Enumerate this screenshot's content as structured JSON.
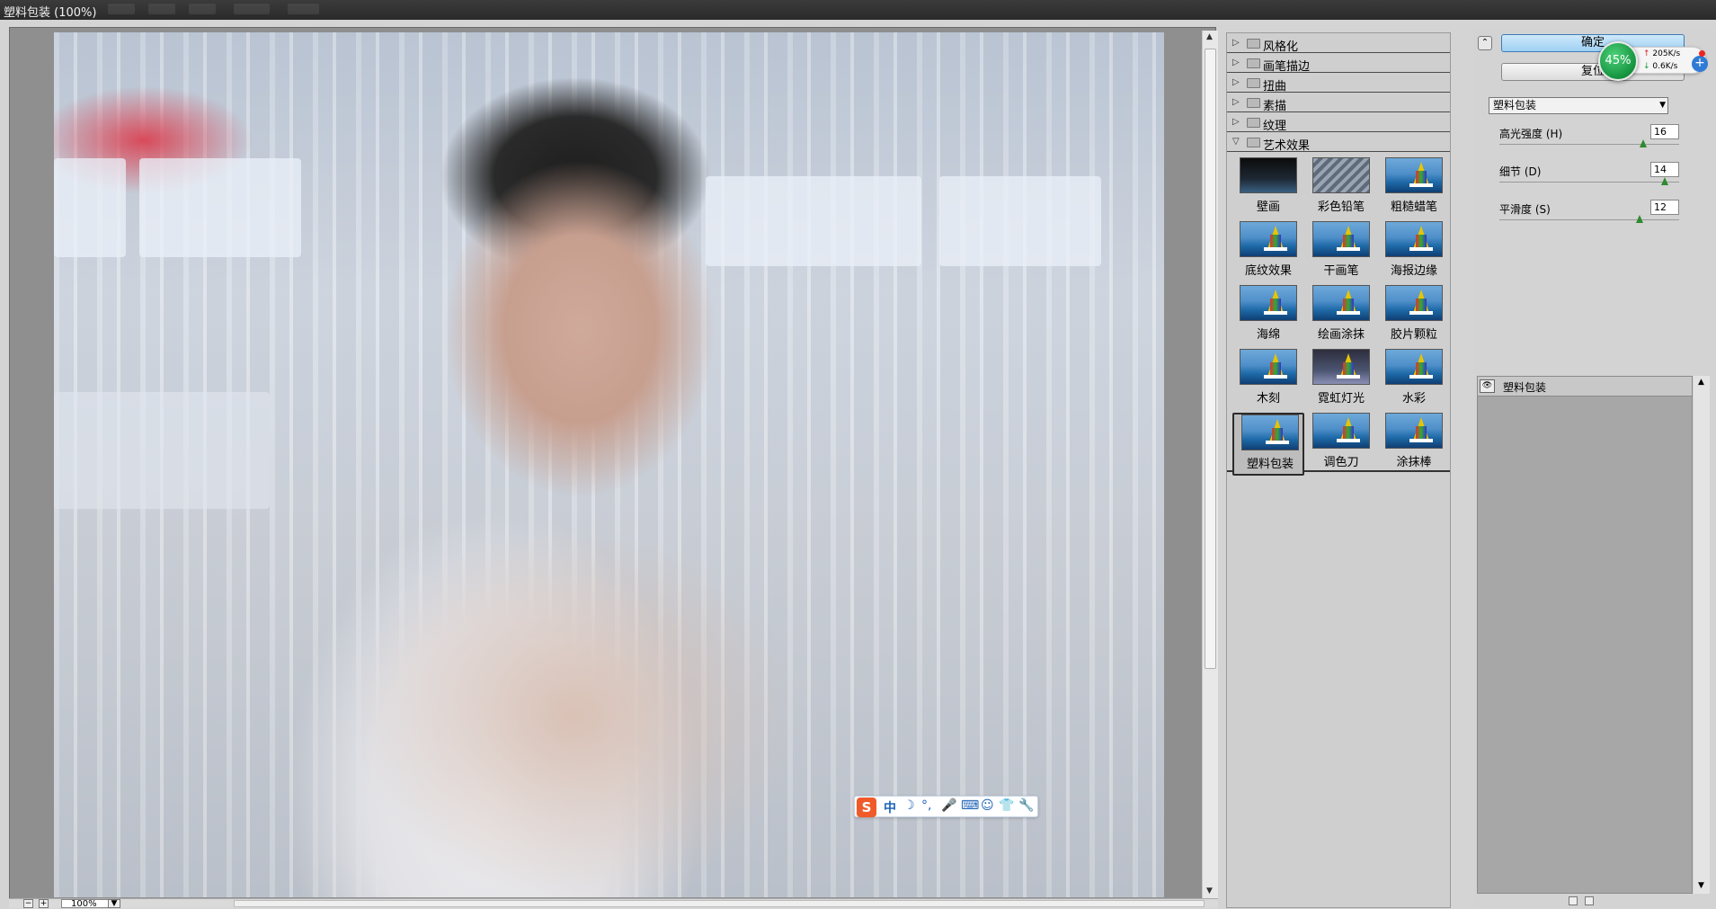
{
  "window": {
    "title": "塑料包装 (100%)"
  },
  "preview": {
    "zoom": "100%",
    "zoom_minus": "−",
    "zoom_plus": "+",
    "zoom_dropdown": "▼"
  },
  "gallery": {
    "folders": [
      {
        "label": "风格化",
        "expanded": false
      },
      {
        "label": "画笔描边",
        "expanded": false
      },
      {
        "label": "扭曲",
        "expanded": false
      },
      {
        "label": "素描",
        "expanded": false
      },
      {
        "label": "纹理",
        "expanded": false
      },
      {
        "label": "艺术效果",
        "expanded": true
      }
    ],
    "filters": [
      {
        "label": "壁画",
        "style": "dark"
      },
      {
        "label": "彩色铅笔",
        "style": "mesh"
      },
      {
        "label": "粗糙蜡笔",
        "style": "sea"
      },
      {
        "label": "底纹效果",
        "style": "sea"
      },
      {
        "label": "干画笔",
        "style": "sea"
      },
      {
        "label": "海报边缘",
        "style": "sea"
      },
      {
        "label": "海绵",
        "style": "sea"
      },
      {
        "label": "绘画涂抹",
        "style": "sea"
      },
      {
        "label": "胶片颗粒",
        "style": "sea"
      },
      {
        "label": "木刻",
        "style": "sea"
      },
      {
        "label": "霓虹灯光",
        "style": "neon"
      },
      {
        "label": "水彩",
        "style": "sea"
      },
      {
        "label": "塑料包装",
        "style": "sea",
        "selected": true
      },
      {
        "label": "调色刀",
        "style": "sea"
      },
      {
        "label": "涂抹棒",
        "style": "sea"
      }
    ]
  },
  "options": {
    "collapse_glyph": "⌃",
    "ok_label": "确定",
    "reset_label": "复位",
    "selected_filter": "塑料包装",
    "dropdown_glyph": "▼",
    "params": [
      {
        "label": "高光强度 (H)",
        "value": "16",
        "level": 0.8
      },
      {
        "label": "细节 (D)",
        "value": "14",
        "level": 0.92
      },
      {
        "label": "平滑度 (S)",
        "value": "12",
        "level": 0.78
      }
    ]
  },
  "layers": {
    "items": [
      {
        "label": "塑料包装",
        "eye": "👁"
      }
    ]
  },
  "network": {
    "percent": "45%",
    "upload": "205K/s",
    "download": "0.6K/s",
    "up_arrow": "↑",
    "down_arrow": "↓",
    "plus": "+"
  },
  "ime": {
    "logo": "S",
    "mode": "中",
    "icons": [
      "☽",
      "°,",
      "🎤",
      "⌨",
      "☺",
      "👕",
      "🔧"
    ]
  },
  "colors": {
    "accent_blue": "#9fd0f3",
    "knob_green": "#2e8a2e",
    "net_green": "#14933f"
  }
}
